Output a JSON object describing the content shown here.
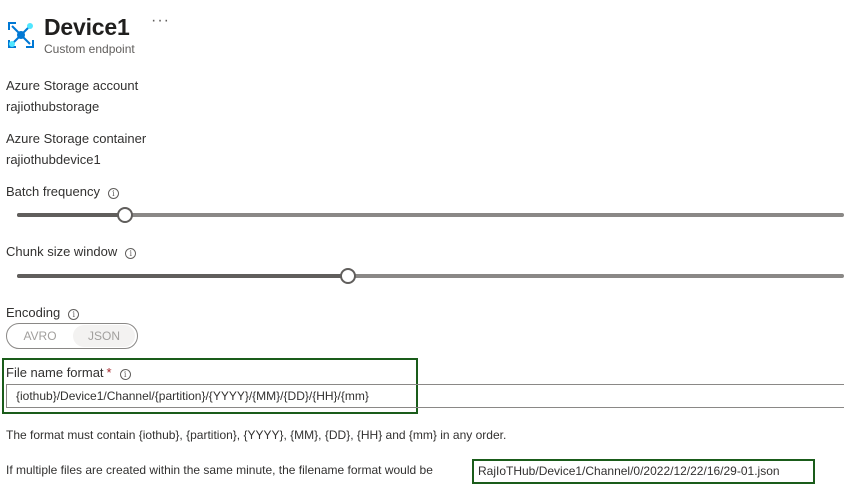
{
  "header": {
    "title": "Device1",
    "subtitle": "Custom endpoint",
    "more_icon": "ellipsis-icon",
    "hub_icon": "iot-hub-icon"
  },
  "fields": {
    "storage_account_label": "Azure Storage account",
    "storage_account_value": "rajiothubstorage",
    "storage_container_label": "Azure Storage container",
    "storage_container_value": "rajiothubdevice1",
    "batch_frequency_label": "Batch frequency",
    "batch_frequency_level": 0.13,
    "chunk_size_label": "Chunk size window",
    "chunk_size_level": 0.4,
    "encoding_label": "Encoding",
    "encoding_options": [
      "AVRO",
      "JSON"
    ],
    "encoding_selected": "JSON",
    "file_name_format_label": "File name format",
    "required_mark": "*",
    "file_name_format_value": "{iothub}/Device1/Channel/{partition}/{YYYY}/{MM}/{DD}/{HH}/{mm}"
  },
  "hints": {
    "format_rule": "The format must contain {iothub}, {partition}, {YYYY}, {MM}, {DD}, {HH} and {mm} in any order.",
    "example_prefix": "If multiple files are created within the same minute, the filename format would be",
    "example_value": "RajIoTHub/Device1/Channel/0/2022/12/22/16/29-01.json"
  },
  "colors": {
    "highlight_border": "#1a5c1a",
    "hub_icon": "#0078d4",
    "required": "#a4262c"
  }
}
